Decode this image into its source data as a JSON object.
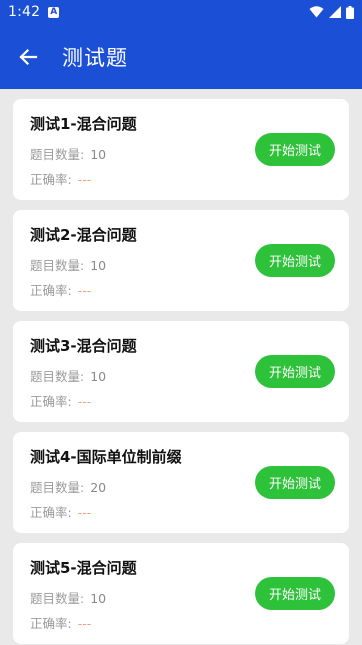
{
  "status_bar": {
    "time": "1:42",
    "notification_letter": "A"
  },
  "header": {
    "title": "测试题"
  },
  "labels": {
    "question_count": "题目数量:",
    "accuracy": "正确率:"
  },
  "tests": [
    {
      "title": "测试1-混合问题",
      "count": "10",
      "accuracy": "---",
      "button": "开始测试"
    },
    {
      "title": "测试2-混合问题",
      "count": "10",
      "accuracy": "---",
      "button": "开始测试"
    },
    {
      "title": "测试3-混合问题",
      "count": "10",
      "accuracy": "---",
      "button": "开始测试"
    },
    {
      "title": "测试4-国际单位制前缀",
      "count": "20",
      "accuracy": "---",
      "button": "开始测试"
    },
    {
      "title": "测试5-混合问题",
      "count": "10",
      "accuracy": "---",
      "button": "开始测试"
    }
  ],
  "colors": {
    "primary": "#1b4fd6",
    "button": "#2ec13a",
    "accuracy_value": "#e9a27a"
  },
  "icons": {
    "back": "arrow-left-icon",
    "wifi": "wifi-icon",
    "signal": "signal-icon",
    "battery": "battery-icon"
  }
}
